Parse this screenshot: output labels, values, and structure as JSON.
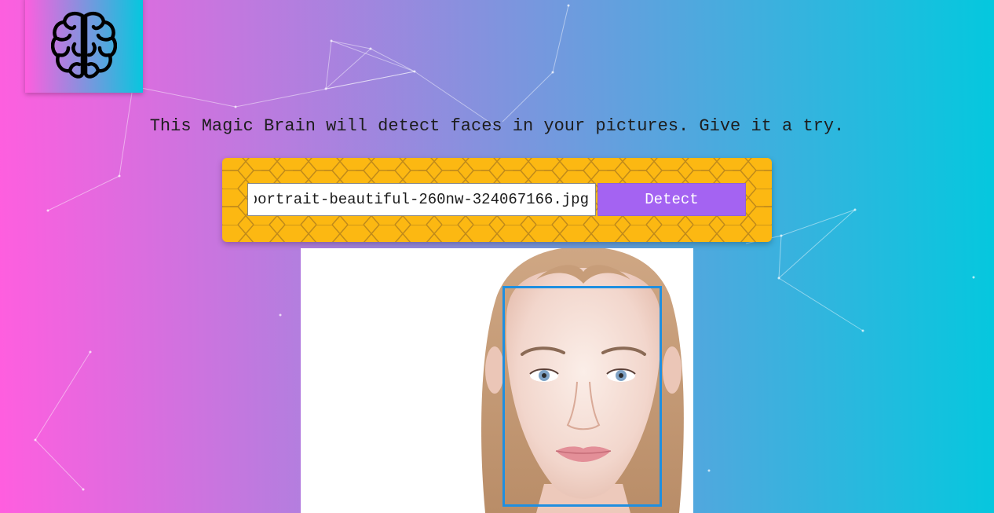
{
  "logo": {
    "icon": "brain-icon",
    "gradient": [
      "#ff5edf",
      "#04c8de"
    ]
  },
  "intro": {
    "text": "This Magic Brain will detect faces in your pictures. Give it a try."
  },
  "form": {
    "image_url": "https://image.shutterstock.com/image-photo/portrait-beautiful-260nw-324067166.jpg",
    "detect_label": "Detect",
    "panel_color": "#fcb812",
    "button_color": "#a463f2"
  },
  "result": {
    "box_color": "#1f8fe0"
  },
  "theme": {
    "gradient_start": "#ff5edf",
    "gradient_end": "#04c8de"
  }
}
